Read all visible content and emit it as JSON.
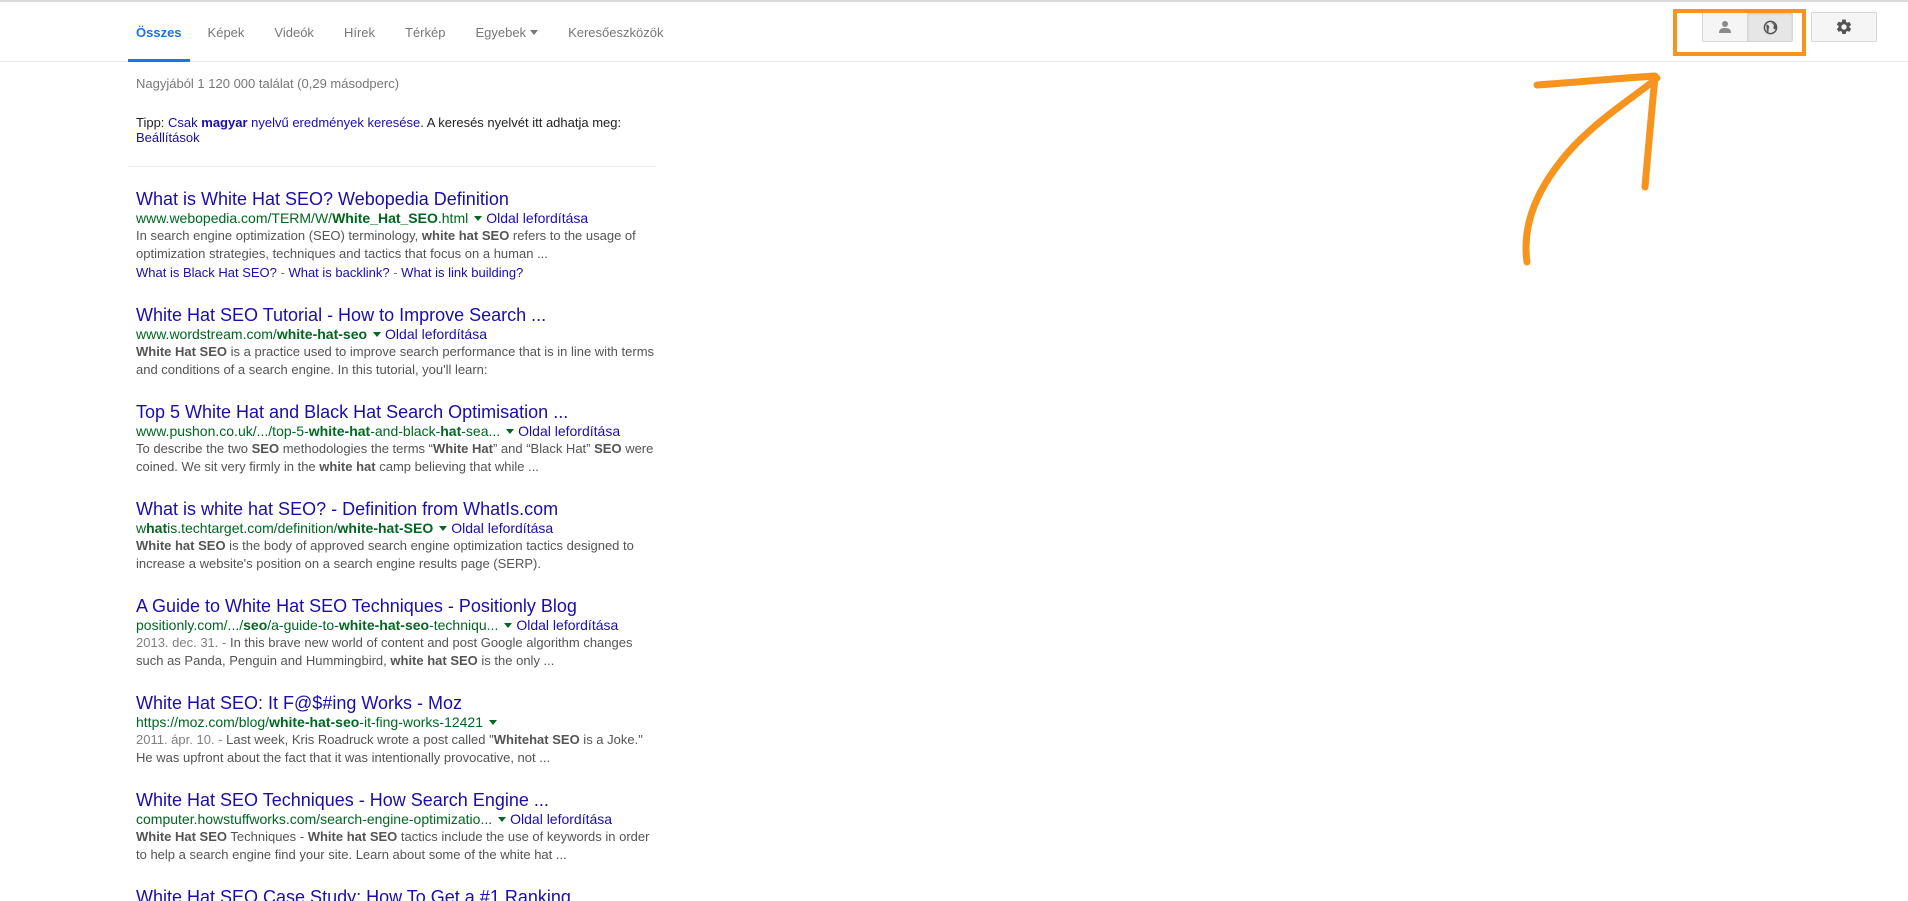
{
  "nav": {
    "tabs": [
      {
        "label": "Összes"
      },
      {
        "label": "Képek"
      },
      {
        "label": "Videók"
      },
      {
        "label": "Hírek"
      },
      {
        "label": "Térkép"
      },
      {
        "label": "Egyebek"
      },
      {
        "label": "Keresőeszközök"
      }
    ],
    "active_tab": "Összes"
  },
  "stats": "Nagyjából 1 120 000 találat (0,29 másodperc)",
  "tip": {
    "prefix": "Tipp: ",
    "link_pre": "Csak ",
    "link_bold": "magyar",
    "link_post": " nyelvű eredmények keresése",
    "middle": ". A keresés nyelvét itt adhatja meg:",
    "settings_link": "Beállítások"
  },
  "results": [
    {
      "title": "What is White Hat SEO? Webopedia Definition",
      "url": {
        "a": "www.webopedia.com/TERM/W/",
        "b": "White_Hat_SEO",
        "c": ".html",
        "d": "",
        "e": ""
      },
      "translate": "Oldal lefordítása",
      "date": "",
      "snippet": [
        {
          "t": "In search engine optimization (SEO) terminology, "
        },
        {
          "t": "white hat SEO",
          "b": true
        },
        {
          "t": " refers to the usage of optimization strategies, techniques and tactics that focus on a human ..."
        }
      ],
      "sitelinks": [
        "What is Black Hat SEO?",
        "What is backlink?",
        "What is link building?"
      ]
    },
    {
      "title": "White Hat SEO Tutorial - How to Improve Search ...",
      "url": {
        "a": "www.wordstream.com/",
        "b": "white-hat-seo",
        "c": "",
        "d": "",
        "e": ""
      },
      "translate": "Oldal lefordítása",
      "date": "",
      "snippet": [
        {
          "t": "White Hat SEO",
          "b": true
        },
        {
          "t": " is a practice used to improve search performance that is in line with terms and conditions of a search engine. In this tutorial, you'll learn:"
        }
      ],
      "sitelinks": []
    },
    {
      "title": "Top 5 White Hat and Black Hat Search Optimisation ...",
      "url": {
        "a": "www.pushon.co.uk/.../top-5-",
        "b": "white-hat",
        "c": "-and-black-",
        "d": "hat",
        "e": "-sea..."
      },
      "translate": "Oldal lefordítása",
      "date": "",
      "snippet": [
        {
          "t": "To describe the two "
        },
        {
          "t": "SEO",
          "b": true
        },
        {
          "t": " methodologies the terms “"
        },
        {
          "t": "White Hat",
          "b": true
        },
        {
          "t": "” and “Black Hat” "
        },
        {
          "t": "SEO",
          "b": true
        },
        {
          "t": " were coined. We sit very firmly in the "
        },
        {
          "t": "white hat",
          "b": true
        },
        {
          "t": " camp believing that while ..."
        }
      ],
      "sitelinks": []
    },
    {
      "title": "What is white hat SEO? - Definition from WhatIs.com",
      "url": {
        "a": "w",
        "b": "hat",
        "c": "is.techtarget.com/definition/",
        "d": "white-hat-SEO",
        "e": ""
      },
      "translate": "Oldal lefordítása",
      "date": "",
      "snippet": [
        {
          "t": "White hat SEO",
          "b": true
        },
        {
          "t": " is the body of approved search engine optimization tactics designed to increase a website's position on a search engine results page (SERP)."
        }
      ],
      "sitelinks": []
    },
    {
      "title": "A Guide to White Hat SEO Techniques - Positionly Blog",
      "url": {
        "a": "positionly.com/.../",
        "b": "seo",
        "c": "/a-guide-to-",
        "d": "white-hat-seo",
        "e": "-techniqu..."
      },
      "translate": "Oldal lefordítása",
      "date": "2013. dec. 31. - ",
      "snippet": [
        {
          "t": "In this brave new world of content and post Google algorithm changes such as Panda, Penguin and Hummingbird, "
        },
        {
          "t": "white hat SEO",
          "b": true
        },
        {
          "t": " is the only ..."
        }
      ],
      "sitelinks": []
    },
    {
      "title": "White Hat SEO: It F@$#ing Works - Moz",
      "url": {
        "a": "https://moz.com/blog/",
        "b": "white-hat-seo",
        "c": "-it-fing-works-12421",
        "d": "",
        "e": ""
      },
      "translate": "",
      "date": "2011. ápr. 10. - ",
      "snippet": [
        {
          "t": "Last week, Kris Roadruck wrote a post called \""
        },
        {
          "t": "Whitehat SEO",
          "b": true
        },
        {
          "t": " is a Joke.\" He was upfront about the fact that it was intentionally provocative, not ..."
        }
      ],
      "sitelinks": []
    },
    {
      "title": "White Hat SEO Techniques - How Search Engine ...",
      "url": {
        "a": "computer.howstuffworks.com/search-engine-optimizatio...",
        "b": "",
        "c": "",
        "d": "",
        "e": ""
      },
      "translate": "Oldal lefordítása",
      "date": "",
      "snippet": [
        {
          "t": "White Hat SEO",
          "b": true
        },
        {
          "t": " Techniques - "
        },
        {
          "t": "White hat SEO",
          "b": true
        },
        {
          "t": " tactics include the use of keywords in order to help a search engine find your site. Learn about some of the white hat ..."
        }
      ],
      "sitelinks": []
    },
    {
      "title": "White Hat SEO Case Study: How To Get a #1 Ranking",
      "url": {
        "a": "",
        "b": "",
        "c": "",
        "d": "",
        "e": ""
      },
      "translate": "",
      "date": "",
      "snippet": [],
      "sitelinks": []
    }
  ],
  "icons": {
    "personal": "person-icon",
    "global": "globe-icon",
    "settings": "gear-icon"
  },
  "colors": {
    "accent": "#1a73e8",
    "link": "#1a0dab",
    "url": "#006621",
    "annotation": "#f7941d"
  }
}
